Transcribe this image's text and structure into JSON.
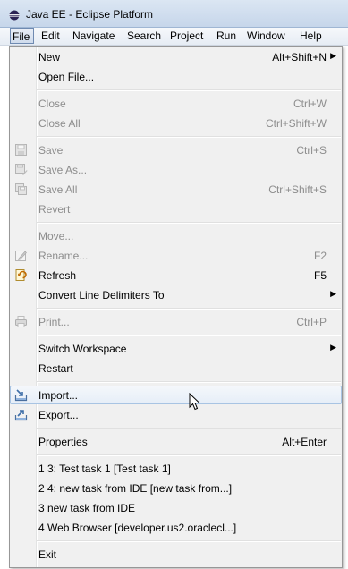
{
  "window": {
    "title": "Java EE - Eclipse Platform"
  },
  "menubar": {
    "items": [
      "File",
      "Edit",
      "Navigate",
      "Search",
      "Project",
      "Run",
      "Window",
      "Help"
    ],
    "active": "File"
  },
  "file_menu": {
    "new": {
      "label": "New",
      "shortcut": "Alt+Shift+N"
    },
    "open_file": {
      "label": "Open File..."
    },
    "close": {
      "label": "Close",
      "shortcut": "Ctrl+W"
    },
    "close_all": {
      "label": "Close All",
      "shortcut": "Ctrl+Shift+W"
    },
    "save": {
      "label": "Save",
      "shortcut": "Ctrl+S"
    },
    "save_as": {
      "label": "Save As..."
    },
    "save_all": {
      "label": "Save All",
      "shortcut": "Ctrl+Shift+S"
    },
    "revert": {
      "label": "Revert"
    },
    "move": {
      "label": "Move..."
    },
    "rename": {
      "label": "Rename...",
      "shortcut": "F2"
    },
    "refresh": {
      "label": "Refresh",
      "shortcut": "F5"
    },
    "convert": {
      "label": "Convert Line Delimiters To"
    },
    "print": {
      "label": "Print...",
      "shortcut": "Ctrl+P"
    },
    "switch_workspace": {
      "label": "Switch Workspace"
    },
    "restart": {
      "label": "Restart"
    },
    "import": {
      "label": "Import..."
    },
    "export": {
      "label": "Export..."
    },
    "properties": {
      "label": "Properties",
      "shortcut": "Alt+Enter"
    },
    "recent": [
      "1 3: Test task 1  [Test task 1]",
      "2 4: new task from IDE  [new task from...]",
      "3 new task from IDE",
      "4 Web Browser  [developer.us2.oraclecl...]"
    ],
    "exit": {
      "label": "Exit"
    }
  },
  "colors": {
    "hover_border": "#a8c4e3",
    "disabled_text": "#8d8d8d",
    "menu_bg": "#f0f0f0"
  }
}
